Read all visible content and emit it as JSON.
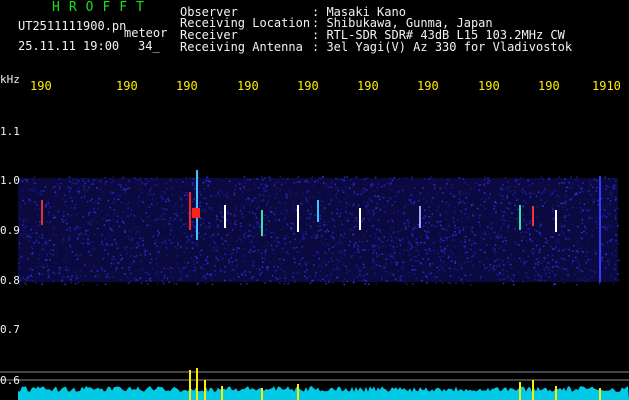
{
  "header": {
    "title": "HROFFT",
    "file_name": "UT2511111900.pn",
    "file_suffix": "meteor",
    "date_time": "25.11.11 19:00",
    "seconds": "34_",
    "meta": [
      {
        "key": "Observer",
        "value": ": Masaki Kano"
      },
      {
        "key": "Receiving Location",
        "value": ": Shibukawa, Gunma, Japan"
      },
      {
        "key": "Receiver",
        "value": ": RTL-SDR SDR# 43dB L15 103.2MHz CW"
      },
      {
        "key": "Receiving Antenna",
        "value": ": 3el Yagi(V) Az 330 for Vladivostok"
      }
    ]
  },
  "axes": {
    "y_unit": "kHz",
    "y_labels": [
      "1.1",
      "1.0",
      "0.9",
      "0.8",
      "0.7",
      "0.6"
    ],
    "time_labels": [
      "190",
      "190",
      "190",
      "190",
      "190",
      "190",
      "190",
      "190",
      "190",
      "1910"
    ]
  },
  "colors": {
    "background": "#000000",
    "title": "#19e019",
    "text": "#f2f2f2",
    "time_axis": "#ffee00",
    "noise_band": "#1c1ca8",
    "meteor_echo": "#ff2020",
    "power_trace": "#00e0ff"
  }
}
